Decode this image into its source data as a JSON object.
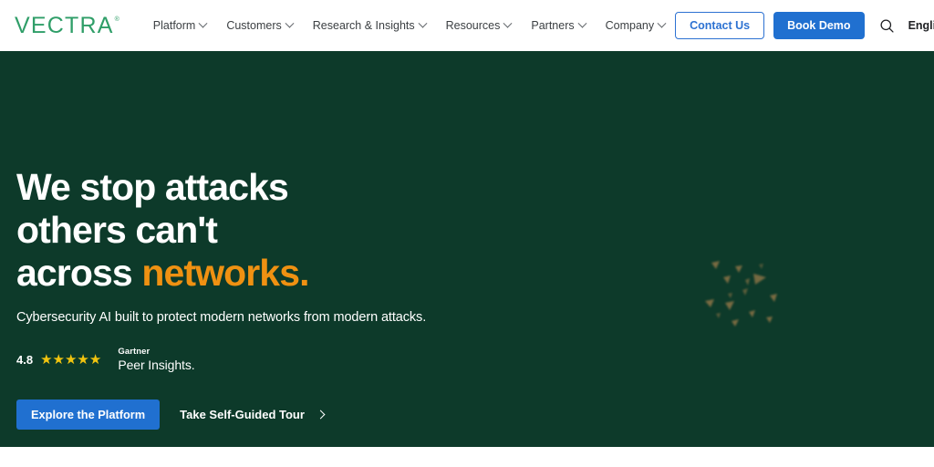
{
  "header": {
    "logo": {
      "text": "VECTRA",
      "trademark": "®",
      "color": "#2f9e68"
    },
    "nav_items": [
      {
        "label": "Platform",
        "icon": "chevron-down-icon"
      },
      {
        "label": "Customers",
        "icon": "chevron-down-icon"
      },
      {
        "label": "Research & Insights",
        "icon": "chevron-down-icon"
      },
      {
        "label": "Resources",
        "icon": "chevron-down-icon"
      },
      {
        "label": "Partners",
        "icon": "chevron-down-icon"
      },
      {
        "label": "Company",
        "icon": "chevron-down-icon"
      }
    ],
    "contact_label": "Contact Us",
    "demo_label": "Book Demo",
    "search_icon": "search-icon",
    "language": "English",
    "language_icon": "chevron-down-icon"
  },
  "hero": {
    "background_color": "#0d3a2a",
    "headline_line1": "We stop attacks",
    "headline_line2": "others can't",
    "headline_line3_plain": "across ",
    "headline_line3_accent": "networks.",
    "accent_color": "#ef9112",
    "subheadline": "Cybersecurity AI built to protect modern networks from modern attacks.",
    "rating": {
      "score": "4.8",
      "stars": "★★★★★",
      "star_color": "#f1c40f",
      "brand_line1": "Gartner",
      "brand_line2": "Peer Insights."
    },
    "cta_primary": "Explore the Platform",
    "cta_primary_color": "#2070d0",
    "cta_secondary": "Take Self-Guided Tour",
    "cta_secondary_icon": "chevron-right-icon",
    "decoration": "particle-cluster-graphic"
  }
}
